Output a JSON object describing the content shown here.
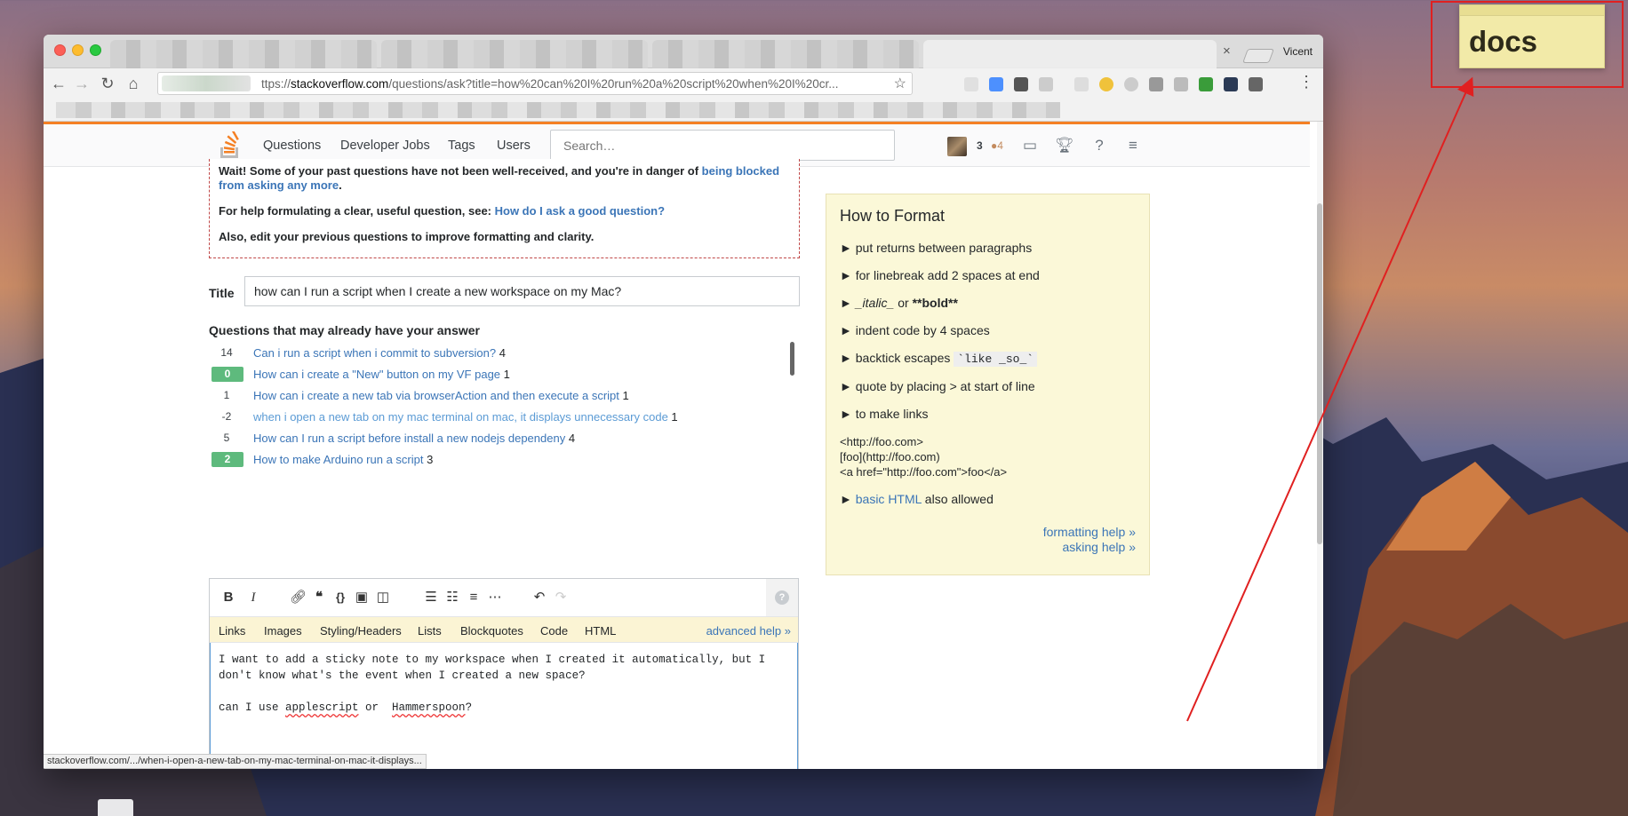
{
  "browser": {
    "profile_name": "Vicent",
    "tab_close": "×",
    "url_prefix": "ttps://",
    "url_host": "stackoverflow.com",
    "url_path": "/questions/ask?title=how%20can%20I%20run%20a%20script%20when%20I%20cr...",
    "status_bar_text": "stackoverflow.com/.../when-i-open-a-new-tab-on-my-mac-terminal-on-mac-it-displays..."
  },
  "so_header": {
    "nav_items": [
      "Questions",
      "Developer Jobs",
      "Tags",
      "Users"
    ],
    "search_placeholder": "Search…",
    "reputation": "3",
    "bronze_badges": "●4"
  },
  "warning": {
    "line1_text": "Wait! Some of your past questions have not been well-received, and you're in danger of ",
    "line1_link": "being blocked from asking any more",
    "line1_end": ".",
    "line2_text": "For help formulating a clear, useful question, see: ",
    "line2_link": "How do I ask a good question?",
    "line3_text": "Also, edit your previous questions to improve formatting and clarity."
  },
  "question_form": {
    "title_label": "Title",
    "title_value": "how can I run a script when I create a new workspace on my Mac?",
    "similar_heading": "Questions that may already have your answer",
    "similar": [
      {
        "votes": "14",
        "answered": false,
        "title": "Can i run a script when i commit to subversion?",
        "answers": "4",
        "visited": false
      },
      {
        "votes": "0",
        "answered": true,
        "title": "How can i create a \"New\" button on my VF page",
        "answers": "1",
        "visited": false
      },
      {
        "votes": "1",
        "answered": false,
        "title": "How can i create a new tab via browserAction and then execute a script",
        "answers": "1",
        "visited": false
      },
      {
        "votes": "-2",
        "answered": false,
        "title": "when i open a new tab on my mac terminal on mac, it displays unnecessary code",
        "answers": "1",
        "visited": true
      },
      {
        "votes": "5",
        "answered": false,
        "title": "How can I run a script before install a new nodejs dependeny",
        "answers": "4",
        "visited": false
      },
      {
        "votes": "2",
        "answered": true,
        "title": "How to make Arduino run a script",
        "answers": "3",
        "visited": false
      }
    ]
  },
  "editor": {
    "tabs": [
      "Links",
      "Images",
      "Styling/Headers",
      "Lists",
      "Blockquotes",
      "Code",
      "HTML"
    ],
    "advanced_help": "advanced help »",
    "help_icon": "?",
    "body_line1": "I want to add a sticky note to my workspace  when I created it automatically, but I",
    "body_line2": "don't know what's the event when I created a new space?",
    "body_line3_a": "can I use ",
    "body_line3_word1": "applescript",
    "body_line3_b": " or  ",
    "body_line3_word2": "Hammerspoon",
    "body_line3_c": "?"
  },
  "how_to_format": {
    "title": "How to Format",
    "items": [
      "► put returns between paragraphs",
      "► for linebreak add 2 spaces at end",
      "► indent code by 4 spaces",
      "► quote by placing > at start of line",
      "► to make links"
    ],
    "italic_bold_prefix": "► ",
    "italic_text": "_italic_",
    "italic_bold_or": " or ",
    "bold_text": "**bold**",
    "backtick_prefix": "► backtick escapes ",
    "backtick_code": "`like _so_`",
    "link_example_1": "<http://foo.com>",
    "link_example_2": "[foo](http://foo.com)",
    "link_example_3": "<a href=\"http://foo.com\">foo</a>",
    "html_prefix": "► ",
    "html_link": "basic HTML",
    "html_suffix": " also allowed",
    "formatting_help": "formatting help »",
    "asking_help": "asking help »"
  },
  "desktop": {
    "sticky_note_text": "docs",
    "annotation_color": "#e02020"
  },
  "colors": {
    "so_orange": "#f48024",
    "link_blue": "#3b75b7",
    "answered_green": "#5eba7d",
    "format_box_bg": "#fbf8d8"
  }
}
